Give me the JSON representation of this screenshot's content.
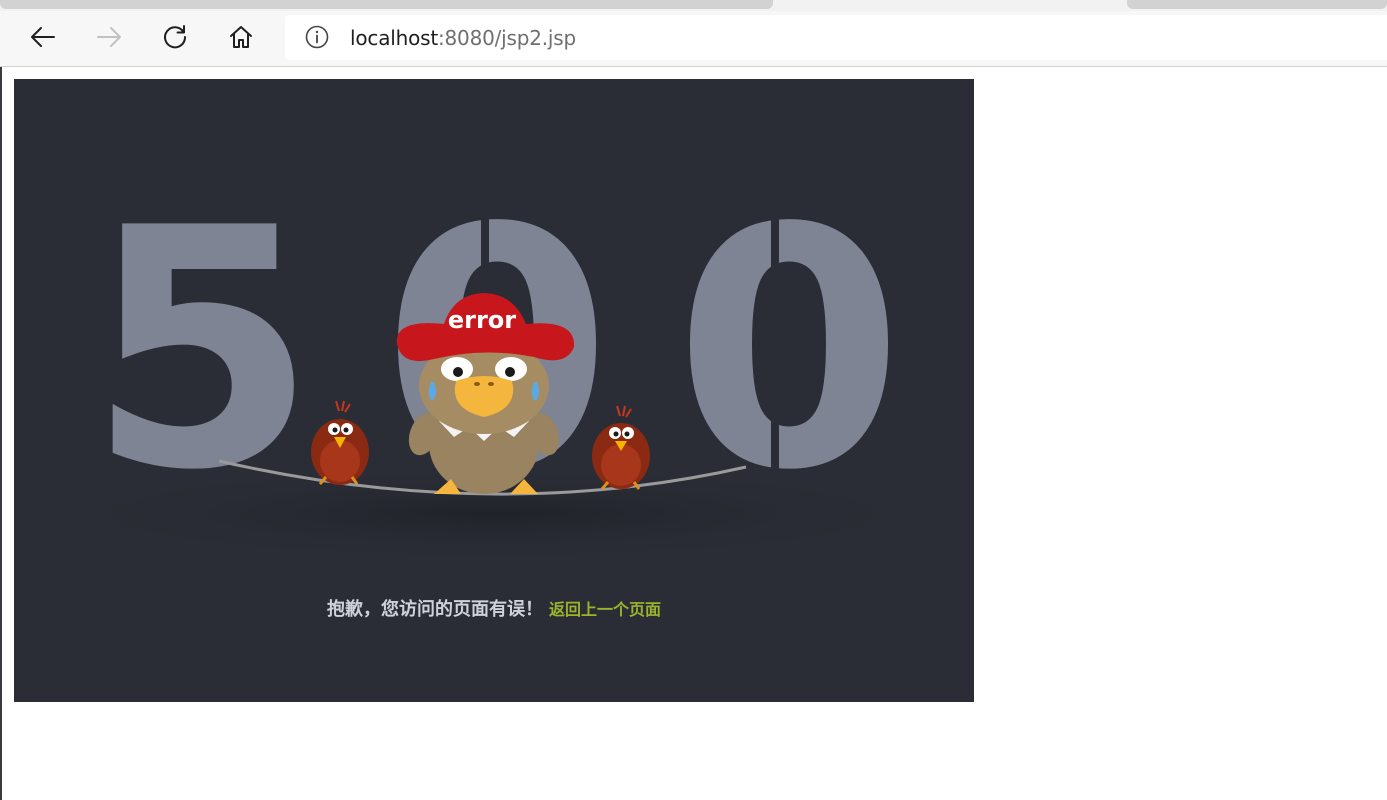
{
  "browser": {
    "url_host": "localhost",
    "url_path": ":8080/jsp2.jsp",
    "icons": {
      "back": "arrow-left-icon",
      "forward": "arrow-right-icon",
      "refresh": "refresh-icon",
      "home": "home-icon",
      "site_info": "info-icon"
    }
  },
  "error_page": {
    "status_code": "500",
    "hat_text": "error",
    "message": "抱歉，您访问的页面有误！",
    "back_link": "返回上一个页面",
    "colors": {
      "background": "#2a2d35",
      "digits": "#7e8494",
      "hat": "#c8171c",
      "link": "#9bb42c",
      "message": "#cfd2d8"
    }
  }
}
